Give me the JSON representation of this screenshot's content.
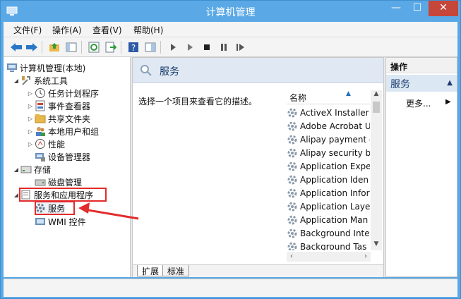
{
  "window": {
    "title": "计算机管理",
    "min_glyph": "—",
    "max_glyph": "☐",
    "close_glyph": "✕"
  },
  "menu": [
    {
      "label": "文件(F)"
    },
    {
      "label": "操作(A)"
    },
    {
      "label": "查看(V)"
    },
    {
      "label": "帮助(H)"
    }
  ],
  "tree": {
    "root": "计算机管理(本地)",
    "system_tools": "系统工具",
    "task_scheduler": "任务计划程序",
    "event_viewer": "事件查看器",
    "shared_folders": "共享文件夹",
    "local_users": "本地用户和组",
    "performance": "性能",
    "device_manager": "设备管理器",
    "storage": "存储",
    "disk_management": "磁盘管理",
    "services_apps": "服务和应用程序",
    "services": "服务",
    "wmi": "WMI 控件"
  },
  "main": {
    "header_title": "服务",
    "description": "选择一个项目来查看它的描述。",
    "column_name": "名称",
    "services": [
      "ActiveX Installer",
      "Adobe Acrobat U",
      "Alipay payment c",
      "Alipay security b",
      "Application Expe",
      "Application Iden",
      "Application Infor",
      "Application Laye",
      "Application Man",
      "Background Inte",
      "Background Tas"
    ],
    "tabs": [
      "扩展",
      "标准"
    ]
  },
  "actions": {
    "title": "操作",
    "section": "服务",
    "more": "更多..."
  },
  "colors": {
    "title_bar": "#5aa9e6",
    "highlight": "#e32b2b",
    "close": "#c7463a"
  }
}
